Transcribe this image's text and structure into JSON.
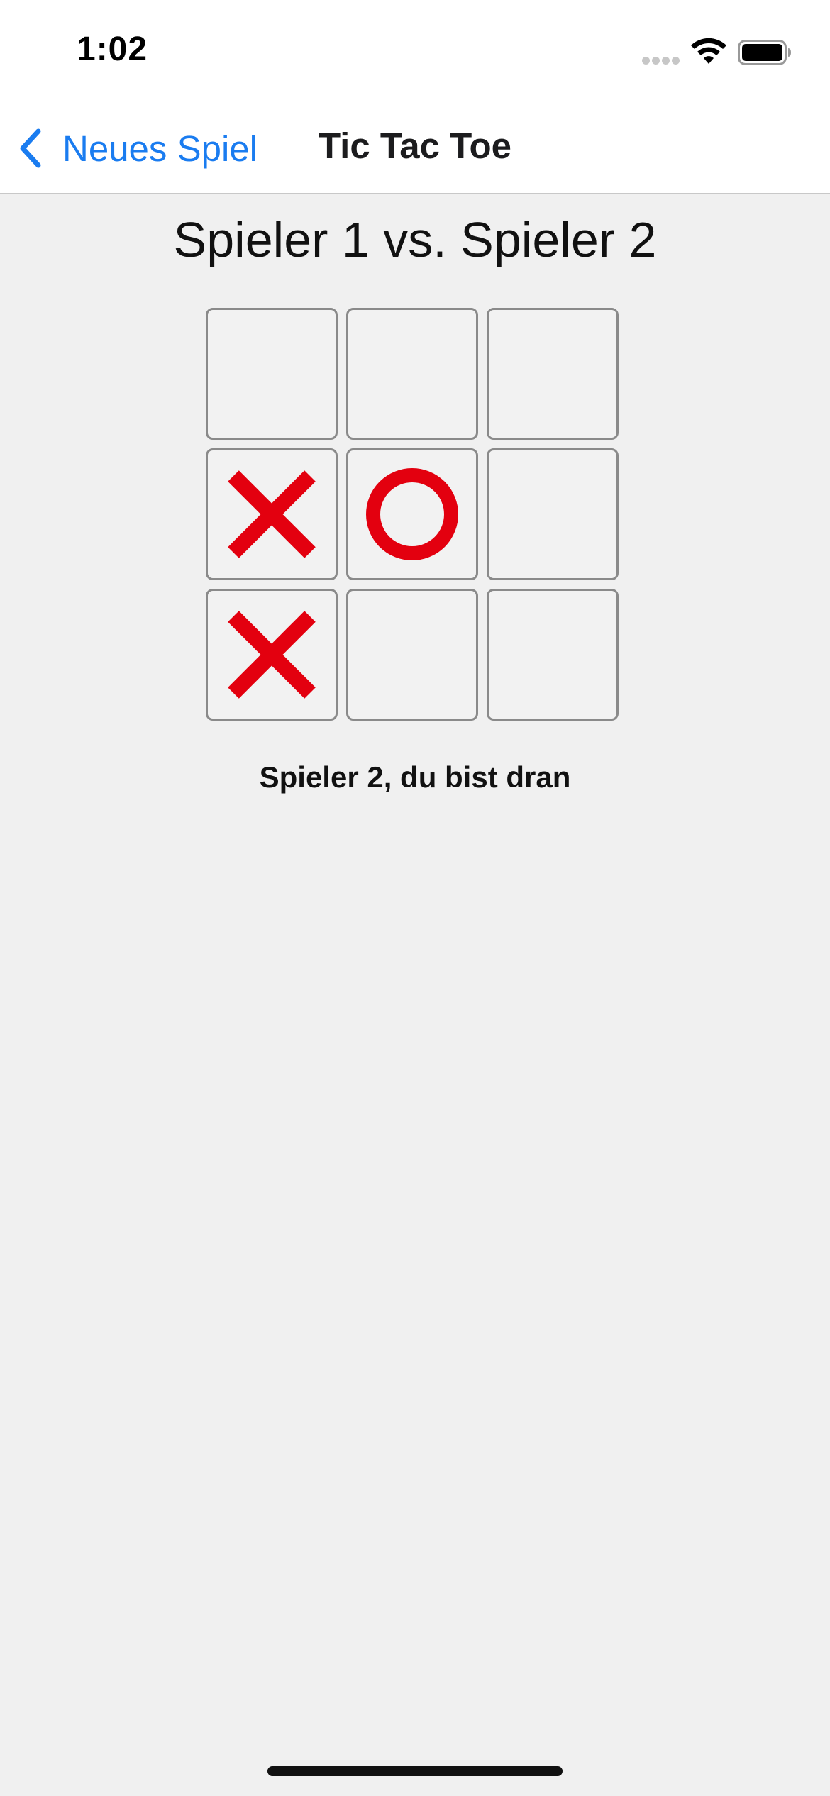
{
  "status_bar": {
    "time": "1:02",
    "icons": [
      "cellular-signal-icon",
      "wifi-icon",
      "battery-icon"
    ]
  },
  "nav": {
    "back_label": "Neues Spiel",
    "back_icon": "chevron-left-icon",
    "title": "Tic Tac Toe"
  },
  "game": {
    "title": "Spieler 1 vs. Spieler 2",
    "board": [
      [
        "",
        "",
        ""
      ],
      [
        "X",
        "O",
        ""
      ],
      [
        "X",
        "",
        ""
      ]
    ],
    "turn_text": "Spieler 2, du bist dran"
  },
  "colors": {
    "accent": "#1a7cf0",
    "mark": "#e3000f",
    "background": "#f0f0f0"
  }
}
